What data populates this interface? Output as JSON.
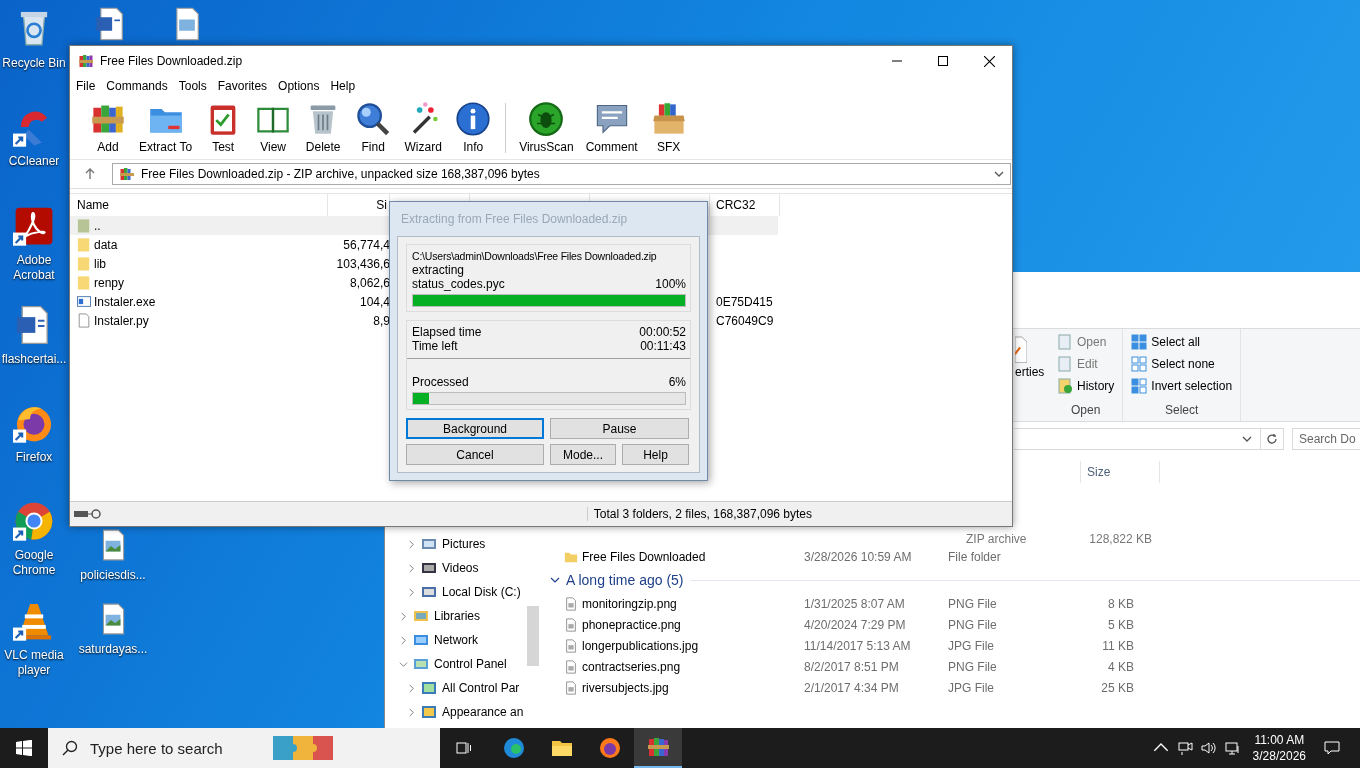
{
  "desktop": {
    "icons": [
      {
        "label": "Recycle Bin"
      },
      {
        "label": "CCleaner"
      },
      {
        "label": "Adobe Acrobat"
      },
      {
        "label": "flashcertai..."
      },
      {
        "label": "Firefox"
      },
      {
        "label": "Google Chrome"
      },
      {
        "label": "VLC media player"
      },
      {
        "label": "policiesdis..."
      },
      {
        "label": "saturdayas..."
      }
    ]
  },
  "explorer": {
    "ribbon": {
      "fragment": "erties",
      "open_items": [
        "Open",
        "Edit",
        "History"
      ],
      "open_group": "Open",
      "select_items": [
        "Select all",
        "Select none",
        "Invert selection"
      ],
      "select_group": "Select"
    },
    "search": {
      "placeholder": "Search Do"
    },
    "size_header": "Size",
    "partial_row": {
      "type": "ZIP archive",
      "size": "128,822 KB"
    },
    "folder_row": {
      "name": "Free Files Downloaded",
      "date": "3/28/2026 10:59 AM",
      "type": "File folder"
    },
    "group": {
      "label": "A long time ago (5)",
      "expanded": true
    },
    "files": [
      {
        "name": "monitoringzip.png",
        "date": "1/31/2025 8:07 AM",
        "type": "PNG File",
        "size": "8 KB"
      },
      {
        "name": "phonepractice.png",
        "date": "4/20/2024 7:29 PM",
        "type": "PNG File",
        "size": "5 KB"
      },
      {
        "name": "longerpublications.jpg",
        "date": "11/14/2017 5:13 AM",
        "type": "JPG File",
        "size": "11 KB"
      },
      {
        "name": "contractseries.png",
        "date": "8/2/2017 8:51 PM",
        "type": "PNG File",
        "size": "4 KB"
      },
      {
        "name": "riversubjects.jpg",
        "date": "2/1/2017 4:34 PM",
        "type": "JPG File",
        "size": "25 KB"
      }
    ],
    "nav": [
      {
        "label": "Pictures",
        "expanded": false
      },
      {
        "label": "Videos",
        "expanded": false
      },
      {
        "label": "Local Disk (C:)",
        "expanded": false
      },
      {
        "label": "Libraries",
        "expanded": false
      },
      {
        "label": "Network",
        "expanded": false
      },
      {
        "label": "Control Panel",
        "expanded": true,
        "children": [
          {
            "label": "All Control Par",
            "expanded": false
          },
          {
            "label": "Appearance an",
            "expanded": false
          }
        ]
      }
    ]
  },
  "winrar": {
    "title": "Free Files Downloaded.zip",
    "menu": [
      "File",
      "Commands",
      "Tools",
      "Favorites",
      "Options",
      "Help"
    ],
    "toolbar": [
      "Add",
      "Extract To",
      "Test",
      "View",
      "Delete",
      "Find",
      "Wizard",
      "Info",
      "VirusScan",
      "Comment",
      "SFX"
    ],
    "address": "Free Files Downloaded.zip - ZIP archive, unpacked size 168,387,096 bytes",
    "columns": [
      "Name",
      "Si",
      "CRC32"
    ],
    "rows": [
      {
        "name": "..",
        "kind": "parent",
        "selected": true
      },
      {
        "name": "data",
        "kind": "folder",
        "size": "56,774,4",
        "selected": false
      },
      {
        "name": "lib",
        "kind": "folder",
        "size": "103,436,6",
        "selected": false
      },
      {
        "name": "renpy",
        "kind": "folder",
        "size": "8,062,6",
        "selected": false
      },
      {
        "name": "Instaler.exe",
        "kind": "exe",
        "size": "104,4",
        "crc": "0E75D415",
        "selected": false
      },
      {
        "name": "Instaler.py",
        "kind": "file",
        "size": "8,9",
        "crc": "C76049C9",
        "selected": false
      }
    ],
    "status": "Total 3 folders, 2 files, 168,387,096 bytes"
  },
  "dialog": {
    "title": "Extracting from Free Files Downloaded.zip",
    "active": false,
    "path": "C:\\Users\\admin\\Downloads\\Free Files Downloaded.zip",
    "action": "extracting",
    "file": "status_codes.pyc",
    "file_percent": "100%",
    "file_progress": {
      "level": 1
    },
    "elapsed_label": "Elapsed time",
    "elapsed": "00:00:52",
    "left_label": "Time left",
    "left": "00:11:43",
    "processed_label": "Processed",
    "processed_percent": "6%",
    "processed_progress": {
      "level": 0.06
    },
    "buttons": [
      {
        "label": "Background",
        "focused": true
      },
      {
        "label": "Pause",
        "focused": false
      },
      {
        "label": "Cancel",
        "focused": false
      },
      {
        "label": "Mode...",
        "focused": false
      },
      {
        "label": "Help",
        "focused": false
      }
    ]
  },
  "taskbar": {
    "search": {
      "placeholder": "Type here to search"
    },
    "apps": [
      {
        "selected": false
      },
      {
        "selected": false
      },
      {
        "selected": false
      },
      {
        "selected": true
      }
    ],
    "clock": {
      "time": "11:00 AM",
      "date": "3/28/2026"
    }
  }
}
